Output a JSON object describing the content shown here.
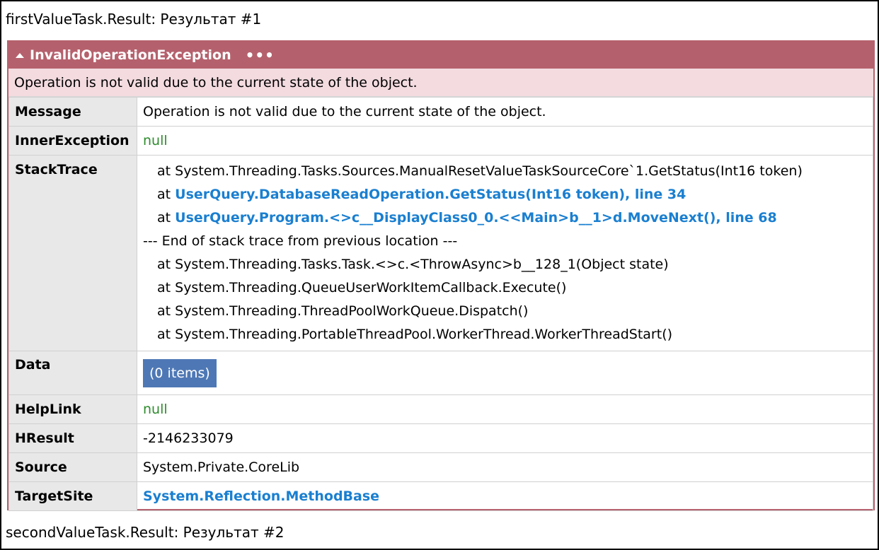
{
  "first_line": "firstValueTask.Result: Результат #1",
  "second_line": "secondValueTask.Result: Результат #2",
  "exception": {
    "type": "InvalidOperationException",
    "more_label": "•••",
    "summary": "Operation is not valid due to the current state of the object.",
    "fields": {
      "message": {
        "key": "Message",
        "value": "Operation is not valid due to the current state of the object."
      },
      "inner": {
        "key": "InnerException",
        "value": "null"
      },
      "stacktrace": {
        "key": "StackTrace",
        "lines": [
          "at System.Threading.Tasks.Sources.ManualResetValueTaskSourceCore`1.GetStatus(Int16 token)",
          "at ",
          "UserQuery.DatabaseReadOperation.GetStatus(Int16 token), line 34",
          "at ",
          "UserQuery.Program.<>c__DisplayClass0_0.<<Main>b__1>d.MoveNext(), line 68",
          "--- End of stack trace from previous location ---",
          "at System.Threading.Tasks.Task.<>c.<ThrowAsync>b__128_1(Object state)",
          "at System.Threading.QueueUserWorkItemCallback.Execute()",
          "at System.Threading.ThreadPoolWorkQueue.Dispatch()",
          "at System.Threading.PortableThreadPool.WorkerThread.WorkerThreadStart()"
        ]
      },
      "data": {
        "key": "Data",
        "value": "(0 items)"
      },
      "helplink": {
        "key": "HelpLink",
        "value": "null"
      },
      "hresult": {
        "key": "HResult",
        "value": "-2146233079"
      },
      "source": {
        "key": "Source",
        "value": "System.Private.CoreLib"
      },
      "targetsite": {
        "key": "TargetSite",
        "value": "System.Reflection.MethodBase"
      }
    }
  },
  "colors": {
    "header_bg": "#b5616d",
    "summary_bg": "#f3dbe0",
    "key_bg": "#e8e8e8",
    "null_text": "#2e8b2e",
    "link_text": "#1a7fd0",
    "button_bg": "#4e78b5"
  },
  "icons": {
    "collapse": "caret-up-icon"
  }
}
